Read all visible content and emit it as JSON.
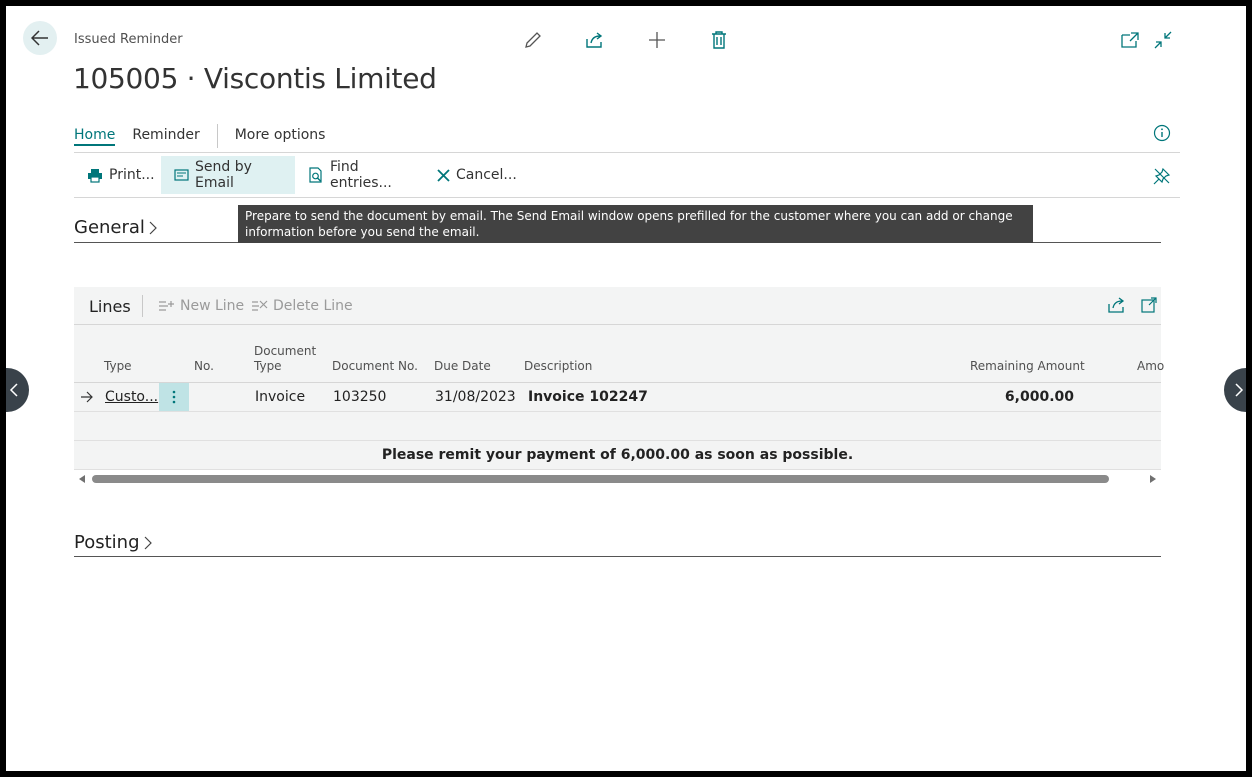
{
  "header": {
    "breadcrumb": "Issued Reminder",
    "title": "105005 · Viscontis Limited"
  },
  "tabs": [
    {
      "label": "Home",
      "active": true
    },
    {
      "label": "Reminder",
      "active": false
    },
    {
      "label": "More options",
      "active": false
    }
  ],
  "actions": {
    "print": "Print...",
    "send_email": "Send by Email",
    "find_entries": "Find entries...",
    "cancel": "Cancel..."
  },
  "tooltip": {
    "text": "Prepare to send the document by email. The Send Email window opens prefilled for the customer where you can add or change information before you send the email."
  },
  "sections": {
    "general": "General",
    "posting": "Posting"
  },
  "lines": {
    "title": "Lines",
    "new_line": "New Line",
    "delete_line": "Delete Line",
    "columns": {
      "type": "Type",
      "no": "No.",
      "doc_type_1": "Document",
      "doc_type_2": "Type",
      "doc_no": "Document No.",
      "due_date": "Due Date",
      "description": "Description",
      "remaining": "Remaining Amount",
      "amount": "Amo"
    },
    "rows": [
      {
        "type": "Custo...",
        "no": "",
        "doc_type": "Invoice",
        "doc_no": "103250",
        "due_date": "31/08/2023",
        "description": "Invoice 102247",
        "remaining": "6,000.00"
      }
    ],
    "footer_text": "Please remit your payment of 6,000.00 as soon as possible."
  },
  "colors": {
    "accent": "#00767a",
    "hover": "#dff1f2",
    "tooltip_bg": "#424242"
  }
}
